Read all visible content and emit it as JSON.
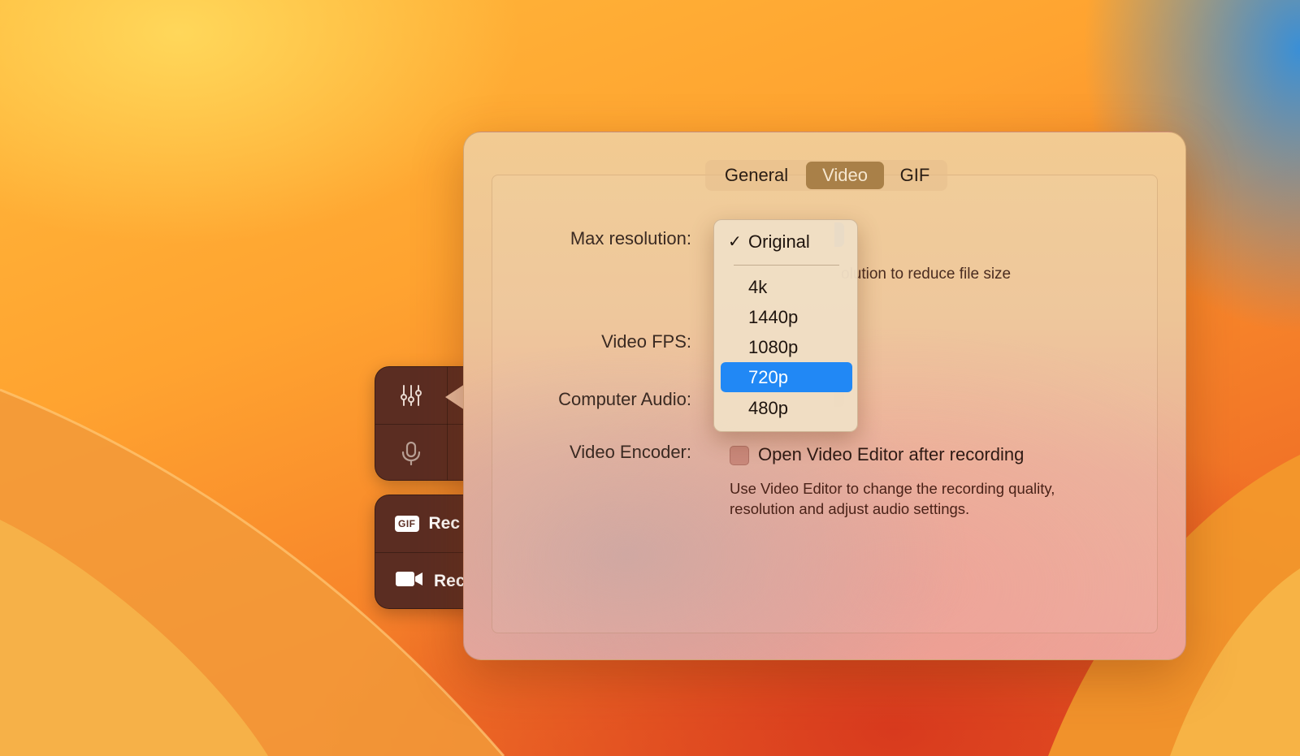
{
  "toolbar": {
    "settings_icon": "sliders-icon",
    "mic_icon": "microphone-icon",
    "record_gif": {
      "badge": "GIF",
      "label": "Rec"
    },
    "record_video": {
      "icon": "video-camera-icon",
      "label": "Rec"
    },
    "accent": "#5b2d22"
  },
  "tabs": [
    {
      "label": "General",
      "selected": false
    },
    {
      "label": "Video",
      "selected": true
    },
    {
      "label": "GIF",
      "selected": false
    }
  ],
  "form": {
    "max_resolution_label": "Max resolution:",
    "max_resolution_hint": "olution to reduce file size",
    "video_fps_label": "Video FPS:",
    "computer_audio_label": "Computer Audio:",
    "video_encoder_label": "Video Encoder:",
    "open_editor_checkbox": {
      "label": "Open Video Editor after recording",
      "checked": false
    },
    "editor_description": "Use Video Editor to change the recording quality, resolution and adjust audio settings."
  },
  "resolution_menu": {
    "checked": "Original",
    "highlighted": "720p",
    "items": [
      "Original",
      "4k",
      "1440p",
      "1080p",
      "720p",
      "480p"
    ],
    "highlight_color": "#2188f5"
  }
}
